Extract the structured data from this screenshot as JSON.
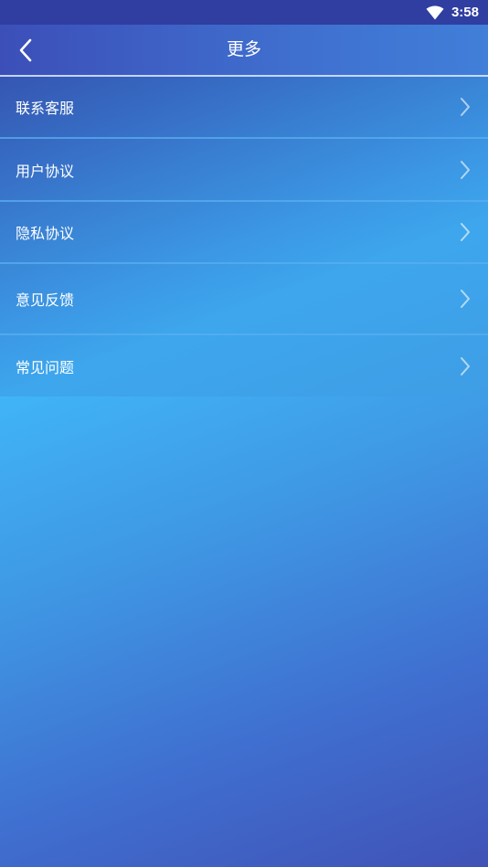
{
  "status_bar": {
    "time": "3:58",
    "icons": [
      "wifi-icon"
    ]
  },
  "header": {
    "title": "更多",
    "back_icon": "chevron-left-icon"
  },
  "menu": {
    "items": [
      {
        "label": "联系客服",
        "icon": "chevron-right-icon"
      },
      {
        "label": "用户协议",
        "icon": "chevron-right-icon"
      },
      {
        "label": "隐私协议",
        "icon": "chevron-right-icon"
      },
      {
        "label": "意见反馈",
        "icon": "chevron-right-icon"
      },
      {
        "label": "常见问题",
        "icon": "chevron-right-icon"
      }
    ]
  },
  "colors": {
    "status_bar": "#2f3ea0",
    "header": "#3f6fcf",
    "background_light": "#40b4f7",
    "background_dark": "#4052b6",
    "text": "#ffffff"
  }
}
